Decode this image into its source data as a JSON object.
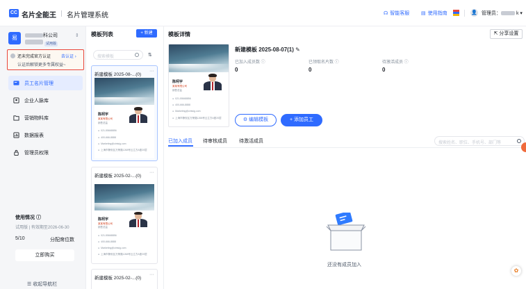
{
  "header": {
    "logo_text": "CC",
    "brand": "名片全能王",
    "page_system": "名片管理系统",
    "links": [
      {
        "label": "智能客服",
        "icon": "headset-icon"
      },
      {
        "label": "使用指南",
        "icon": "doc-icon"
      }
    ],
    "admin_label": "管理员：",
    "admin_suffix": "k"
  },
  "sidebar": {
    "company_initial": "易",
    "company_name_suffix": "科公司",
    "company_tag": "试用版",
    "cert_title": "还未完成官方认证",
    "cert_link": "去认证",
    "cert_sub": "认证后解锁更多专属权益~",
    "nav": [
      {
        "label": "员工名片管理",
        "icon": "card-icon",
        "active": true
      },
      {
        "label": "企业人脉库",
        "icon": "contacts-icon",
        "active": false
      },
      {
        "label": "营销物料库",
        "icon": "folder-icon",
        "active": false
      },
      {
        "label": "数据报表",
        "icon": "chart-icon",
        "active": false
      },
      {
        "label": "管理员权限",
        "icon": "lock-icon",
        "active": false
      }
    ],
    "usage_title": "使用情况 ⓘ",
    "usage_sub": "试用版 | 有效期至2026-06-30",
    "usage_count": "5/10",
    "usage_assign": "分配席位数",
    "buy_label": "立即购买",
    "collapse_label": "收起导航栏"
  },
  "template_list": {
    "heading": "模板列表",
    "new_label": "+ 新建",
    "search_placeholder": "搜索模板",
    "cards": [
      {
        "title": "新建模板 2025-08-...(0)"
      },
      {
        "title": "新建模板 2025-02-...(0)"
      },
      {
        "title": "新建模板 2025-02-...(0)"
      }
    ]
  },
  "mini_card": {
    "name": "陈柯宇",
    "company": "某某有限公司",
    "position": "销售总监",
    "rows": [
      "021-55668856",
      "400-666-8888",
      "Marketing@cintsig.com",
      "上海市静安区万荣路1268号云立方A座20层"
    ]
  },
  "detail": {
    "heading": "模板详情",
    "share_label": "分享设置",
    "template_name": "新建模板 2025-08-07(1)",
    "stats": [
      {
        "label": "已加入成员数 ⓘ",
        "value": "0"
      },
      {
        "label": "已领取名片数 ⓘ",
        "value": "0"
      },
      {
        "label": "待激活成员 ⓘ",
        "value": "0"
      }
    ],
    "edit_label": "编辑模板",
    "add_label": "+ 添加员工",
    "tabs": [
      "已加入成员",
      "待审核成员",
      "待激活成员"
    ],
    "member_search_placeholder": "搜索姓名、职位、手机号、部门等",
    "empty_text": "还没有成员加入"
  },
  "colors": {
    "accent": "#2f6bff",
    "alert_border": "#e8463b",
    "active_nav_bg": "#e5ecff"
  }
}
